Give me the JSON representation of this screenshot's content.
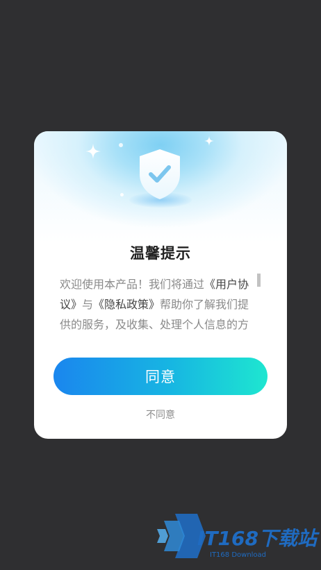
{
  "dialog": {
    "title": "温馨提示",
    "body": {
      "part1": "欢迎使用本产品！我们将通过",
      "user_agreement": "《用户协议》",
      "part2": "与",
      "privacy_policy": "《隐私政策》",
      "part3": "帮助你了解我们提供的服务，及收集、处理个人信息的方式。"
    },
    "agree_label": "同意",
    "disagree_label": "不同意",
    "accent_start": "#1a86ee",
    "accent_end": "#1ee6d0",
    "header_icon": "shield-check-icon"
  },
  "watermark": {
    "main": "IT168下载站",
    "sub": "IT168 Download"
  }
}
